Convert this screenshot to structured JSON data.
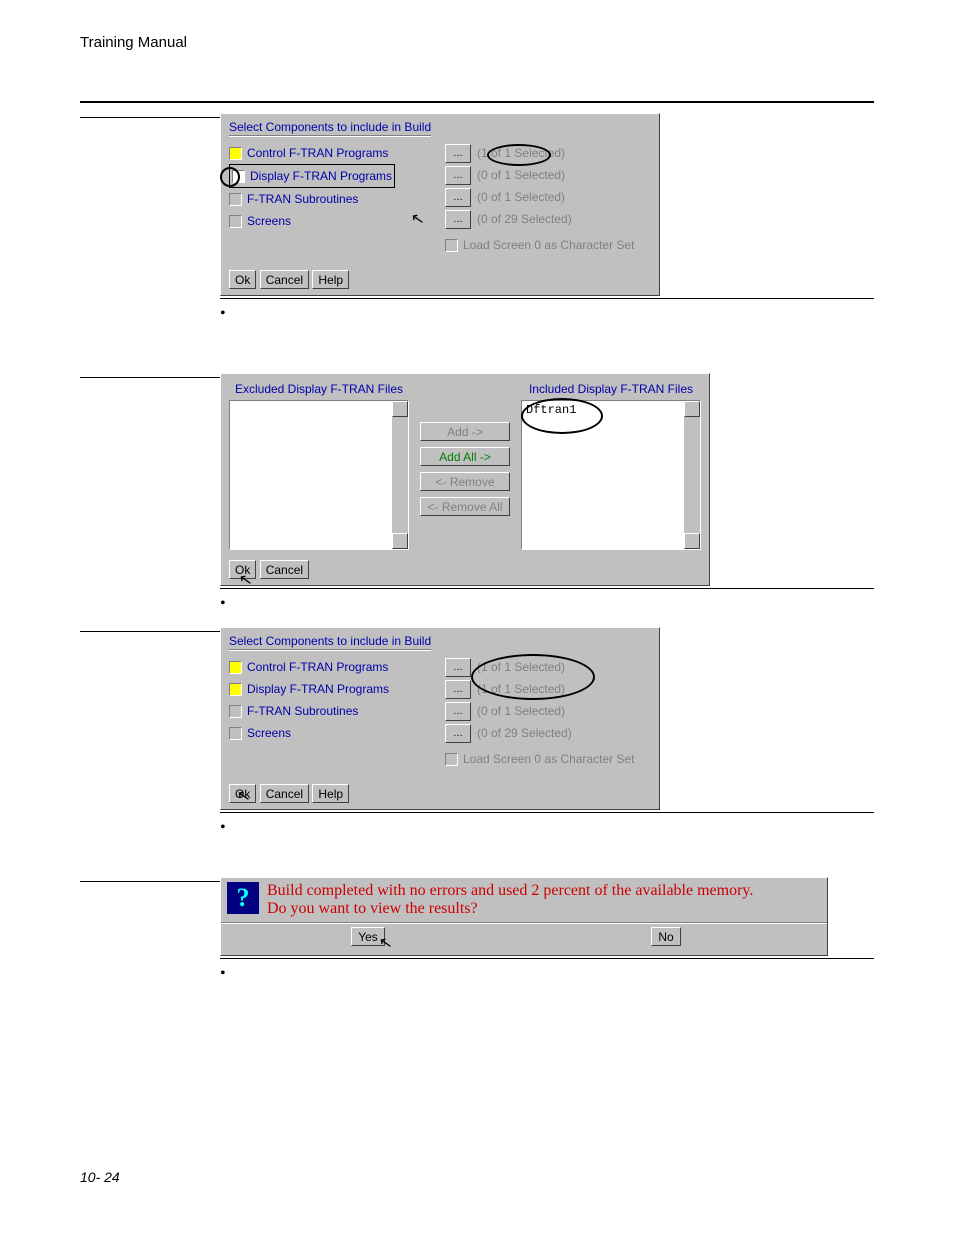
{
  "header": {
    "title": "Training Manual"
  },
  "footer": {
    "page": "10- 24"
  },
  "bullet": "•",
  "dialog1": {
    "title": "Select Components to include in Build",
    "rows": [
      {
        "label": "Control F-TRAN Programs",
        "status": "(1 of 1 Selected)",
        "check": "yellow"
      },
      {
        "label": "Display F-TRAN Programs",
        "status": "(0 of 1 Selected)",
        "check": "white"
      },
      {
        "label": "F-TRAN Subroutines",
        "status": "(0 of 1 Selected)",
        "check": "gray"
      },
      {
        "label": "Screens",
        "status": "(0 of 29 Selected)",
        "check": "gray"
      }
    ],
    "charset": "Load Screen 0 as Character Set",
    "buttons": {
      "ok": "Ok",
      "cancel": "Cancel",
      "help": "Help"
    }
  },
  "dialog2": {
    "left_label": "Excluded Display F-TRAN Files",
    "right_label": "Included Display F-TRAN Files",
    "included_item": "Dftran1",
    "mid": {
      "add": "Add ->",
      "addall": "Add All ->",
      "remove": "<- Remove",
      "removeall": "<- Remove All"
    },
    "buttons": {
      "ok": "Ok",
      "cancel": "Cancel"
    }
  },
  "dialog3": {
    "title": "Select Components to include in Build",
    "rows": [
      {
        "label": "Control F-TRAN Programs",
        "status": "(1 of 1 Selected)",
        "check": "yellow"
      },
      {
        "label": "Display F-TRAN Programs",
        "status": "(1 of 1 Selected)",
        "check": "yellow"
      },
      {
        "label": "F-TRAN Subroutines",
        "status": "(0 of 1 Selected)",
        "check": "gray"
      },
      {
        "label": "Screens",
        "status": "(0 of 29 Selected)",
        "check": "gray"
      }
    ],
    "charset": "Load Screen 0 as Character Set",
    "buttons": {
      "ok": "Ok",
      "cancel": "Cancel",
      "help": "Help"
    }
  },
  "msg": {
    "line1": "Build completed with no errors and used 2 percent of the available memory.",
    "line2": "Do you want to view the results?",
    "yes": "Yes",
    "no": "No"
  }
}
